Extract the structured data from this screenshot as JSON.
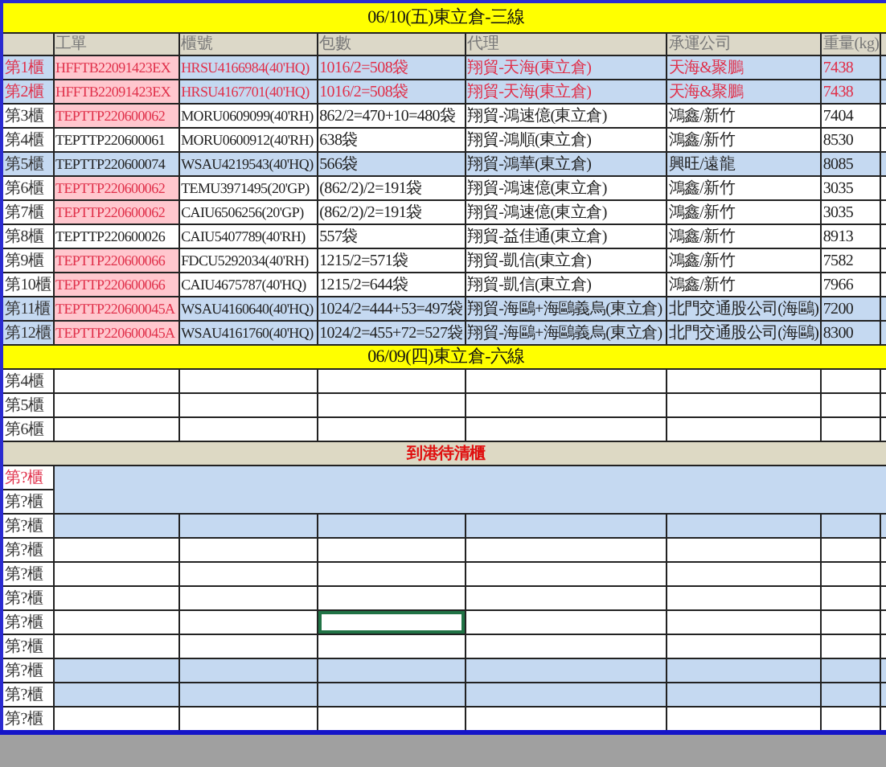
{
  "columns": [
    "工單",
    "櫃號",
    "包數",
    "代理",
    "承運公司",
    "重量(kg)"
  ],
  "blocks": [
    {
      "title": "06/10(五)東立倉-三線",
      "rows": [
        {
          "label": "第1櫃",
          "cells": [
            "HFFTB22091423EX",
            "HRSU4166984(40'HQ)",
            "1016/2=508袋",
            "翔貿-天海(東立倉)",
            "天海&聚鵬",
            "7438"
          ],
          "shaded": true,
          "alert": true,
          "flagged": true
        },
        {
          "label": "第2櫃",
          "cells": [
            "HFFTB22091423EX",
            "HRSU4167701(40'HQ)",
            "1016/2=508袋",
            "翔貿-天海(東立倉)",
            "天海&聚鵬",
            "7438"
          ],
          "shaded": true,
          "alert": true,
          "flagged": true
        },
        {
          "label": "第3櫃",
          "cells": [
            "TEPTTP220600062",
            "MORU0609099(40'RH)",
            "862/2=470+10=480袋",
            "翔貿-鴻速億(東立倉)",
            "鴻鑫/新竹",
            "7404"
          ],
          "shaded": false,
          "alert": false,
          "flagged": true
        },
        {
          "label": "第4櫃",
          "cells": [
            "TEPTTP220600061",
            "MORU0600912(40'RH)",
            "638袋",
            "翔貿-鴻順(東立倉)",
            "鴻鑫/新竹",
            "8530"
          ],
          "shaded": false,
          "alert": false,
          "flagged": false
        },
        {
          "label": "第5櫃",
          "cells": [
            "TEPTTP220600074",
            "WSAU4219543(40'HQ)",
            "566袋",
            "翔貿-鴻華(東立倉)",
            "興旺/遠龍",
            "8085"
          ],
          "shaded": true,
          "alert": false,
          "flagged": false
        },
        {
          "label": "第6櫃",
          "cells": [
            "TEPTTP220600062",
            "TEMU3971495(20'GP)",
            "(862/2)/2=191袋",
            "翔貿-鴻速億(東立倉)",
            "鴻鑫/新竹",
            "3035"
          ],
          "shaded": false,
          "alert": false,
          "flagged": true
        },
        {
          "label": "第7櫃",
          "cells": [
            "TEPTTP220600062",
            "CAIU6506256(20'GP)",
            "(862/2)/2=191袋",
            "翔貿-鴻速億(東立倉)",
            "鴻鑫/新竹",
            "3035"
          ],
          "shaded": false,
          "alert": false,
          "flagged": true
        },
        {
          "label": "第8櫃",
          "cells": [
            "TEPTTP220600026",
            "CAIU5407789(40'RH)",
            "557袋",
            "翔貿-益佳通(東立倉)",
            "鴻鑫/新竹",
            "8913"
          ],
          "shaded": false,
          "alert": false,
          "flagged": false
        },
        {
          "label": "第9櫃",
          "cells": [
            "TEPTTP220600066",
            "FDCU5292034(40'RH)",
            "1215/2=571袋",
            "翔貿-凱信(東立倉)",
            "鴻鑫/新竹",
            "7582"
          ],
          "shaded": false,
          "alert": false,
          "flagged": true
        },
        {
          "label": "第10櫃",
          "cells": [
            "TEPTTP220600066",
            "CAIU4675787(40'HQ)",
            "1215/2=644袋",
            "翔貿-凱信(東立倉)",
            "鴻鑫/新竹",
            "7966"
          ],
          "shaded": false,
          "alert": false,
          "flagged": true
        },
        {
          "label": "第11櫃",
          "cells": [
            "TEPTTP220600045A",
            "WSAU4160640(40'HQ)",
            "1024/2=444+53=497袋",
            "翔貿-海鷗+海鷗義烏(東立倉)",
            "北門交通股公司(海鷗)",
            "7200"
          ],
          "shaded": true,
          "alert": false,
          "flagged": true
        },
        {
          "label": "第12櫃",
          "cells": [
            "TEPTTP220600045A",
            "WSAU4161760(40'HQ)",
            "1024/2=455+72=527袋",
            "翔貿-海鷗+海鷗義烏(東立倉)",
            "北門交通股公司(海鷗)",
            "8300"
          ],
          "shaded": true,
          "alert": false,
          "flagged": true
        }
      ]
    },
    {
      "title": "06/09(四)東立倉-六線",
      "rows": [
        {
          "label": "第4櫃",
          "shaded": false,
          "alert": false
        },
        {
          "label": "第5櫃",
          "shaded": false,
          "alert": false
        },
        {
          "label": "第6櫃",
          "shaded": false,
          "alert": false
        }
      ]
    }
  ],
  "banner": "到港待清櫃",
  "pending": [
    {
      "label": "第?櫃",
      "kind": "merged",
      "shaded": true,
      "alert": true
    },
    {
      "label": "第?櫃",
      "kind": "merged_cont",
      "shaded": true,
      "alert": false
    },
    {
      "label": "第?櫃",
      "kind": "row",
      "shaded": true,
      "alert": false,
      "selected": false
    },
    {
      "label": "第?櫃",
      "kind": "row",
      "shaded": false,
      "alert": false,
      "selected": false
    },
    {
      "label": "第?櫃",
      "kind": "row",
      "shaded": false,
      "alert": false,
      "selected": false
    },
    {
      "label": "第?櫃",
      "kind": "row",
      "shaded": false,
      "alert": false,
      "selected": false
    },
    {
      "label": "第?櫃",
      "kind": "row",
      "shaded": false,
      "alert": false,
      "selected": true
    },
    {
      "label": "第?櫃",
      "kind": "row",
      "shaded": false,
      "alert": false,
      "selected": false
    },
    {
      "label": "第?櫃",
      "kind": "row",
      "shaded": true,
      "alert": false,
      "selected": false
    },
    {
      "label": "第?櫃",
      "kind": "row",
      "shaded": true,
      "alert": false,
      "selected": false
    },
    {
      "label": "第?櫃",
      "kind": "row",
      "shaded": false,
      "alert": false,
      "selected": false
    }
  ]
}
